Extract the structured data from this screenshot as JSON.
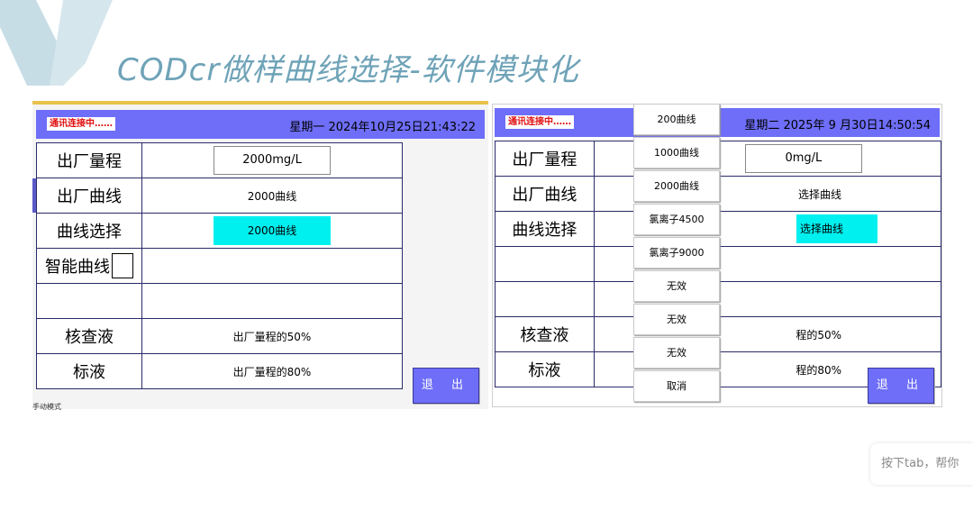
{
  "slide": {
    "title": "CODcr做样曲线选择-软件模块化"
  },
  "left_panel": {
    "status": "通讯连接中……",
    "datetime": "星期一 2024年10月25日21:43:22",
    "rows": {
      "range_label": "出厂量程",
      "range_value": "2000mg/L",
      "curve_label": "出厂曲线",
      "curve_value": "2000曲线",
      "select_label": "曲线选择",
      "select_value": "2000曲线",
      "smart_label": "智能曲线",
      "check_label": "核查液",
      "check_value": "出厂量程的50%",
      "std_label": "标液",
      "std_value": "出厂量程的80%"
    },
    "exit": "退 出",
    "bottom_fragment": "手动模式"
  },
  "right_panel": {
    "status": "通讯连接中……",
    "datetime": "星期二 2025年 9 月30日14:50:54",
    "rows": {
      "range_label": "出厂量程",
      "range_value": "0mg/L",
      "curve_label": "出厂曲线",
      "curve_value": "选择曲线",
      "select_label": "曲线选择",
      "select_value": "选择曲线",
      "check_label": "核查液",
      "check_value": "程的50%",
      "std_label": "标液",
      "std_value": "程的80%"
    },
    "exit": "退 出",
    "dropdown": [
      "200曲线",
      "1000曲线",
      "2000曲线",
      "氯离子4500",
      "氯离子9000",
      "无效",
      "无效",
      "无效",
      "取消"
    ]
  },
  "tooltip": "按下tab，帮你",
  "colors": {
    "header": "#6e6ef8",
    "selected": "#00f0f0",
    "title": "#6fa3b8"
  }
}
